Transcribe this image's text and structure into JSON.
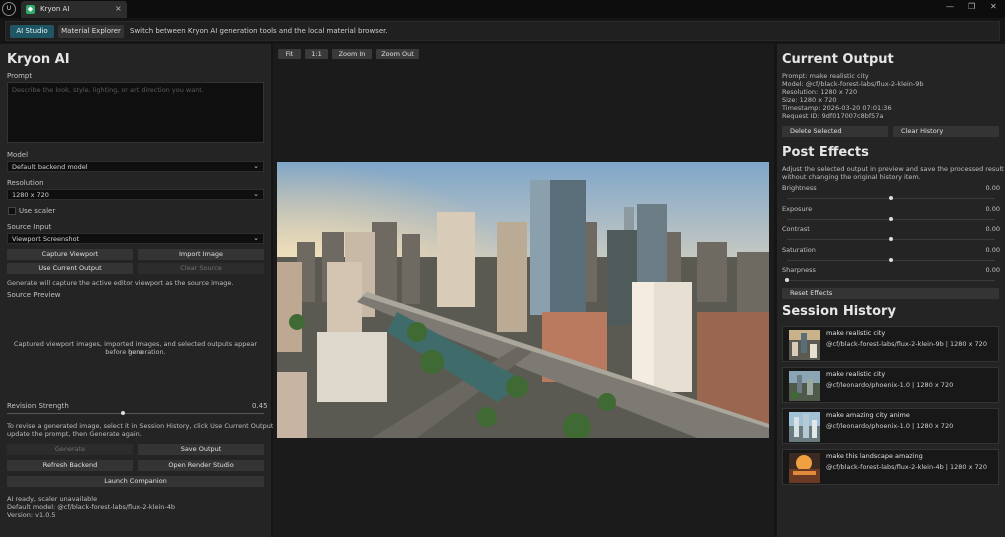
{
  "titlebar": {
    "logo": "U",
    "tab_label": "Kryon AI",
    "tab_close": "×",
    "win_min": "—",
    "win_max": "❐",
    "win_close": "✕"
  },
  "toolbar": {
    "ai_studio": "AI Studio",
    "material_explorer": "Material Explorer",
    "description": "Switch between Kryon AI generation tools and the local material browser."
  },
  "left": {
    "title": "Kryon AI",
    "prompt_label": "Prompt",
    "prompt_placeholder": "Describe the look, style, lighting, or art direction you want.",
    "model_label": "Model",
    "model_value": "Default backend model",
    "resolution_label": "Resolution",
    "resolution_value": "1280 x 720",
    "use_scaler": "Use scaler",
    "source_input_label": "Source Input",
    "source_input_value": "Viewport Screenshot",
    "capture_viewport": "Capture Viewport",
    "import_image": "Import Image",
    "use_current_output": "Use Current Output",
    "clear_source": "Clear Source",
    "source_note": "Generate will capture the active editor viewport as the source image.",
    "source_preview_label": "Source Preview",
    "source_preview_text_1": "Captured viewport images, imported images, and selected outputs appear here",
    "source_preview_text_2": "before generation.",
    "revision_strength_label": "Revision Strength",
    "revision_strength_value": "0.45",
    "revision_strength": 0.45,
    "revise_note_1": "To revise a generated image, select it in Session History, click Use Current Output,",
    "revise_note_2": "update the prompt, then Generate again.",
    "generate": "Generate",
    "save_output": "Save Output",
    "refresh_backend": "Refresh Backend",
    "open_render_studio": "Open Render Studio",
    "launch_companion": "Launch Companion",
    "status_1": "AI ready, scaler unavailable",
    "status_2": "Default model: @cf/black-forest-labs/flux-2-klein-4b",
    "status_3": "Version: v1.0.5"
  },
  "center": {
    "fit": "Fit",
    "one_to_one": "1:1",
    "zoom_in": "Zoom In",
    "zoom_out": "Zoom Out"
  },
  "right": {
    "current_output_title": "Current Output",
    "prompt": "Prompt: make realistic  city",
    "model": "Model: @cf/black-forest-labs/flux-2-klein-9b",
    "resolution": "Resolution: 1280 x 720",
    "size": "Size: 1280 x 720",
    "timestamp": "Timestamp: 2026-03-20 07:01:36",
    "request_id": "Request ID: 9df017007c8bf57a",
    "delete_selected": "Delete Selected",
    "clear_history": "Clear History",
    "post_effects_title": "Post Effects",
    "post_effects_desc_1": "Adjust the selected output in preview and save the processed result",
    "post_effects_desc_2": "without changing the original history item.",
    "effects": [
      {
        "name": "Brightness",
        "value": "0.00",
        "level": 0.5
      },
      {
        "name": "Exposure",
        "value": "0.00",
        "level": 0.5
      },
      {
        "name": "Contrast",
        "value": "0.00",
        "level": 0.5
      },
      {
        "name": "Saturation",
        "value": "0.00",
        "level": 0.5
      },
      {
        "name": "Sharpness",
        "value": "0.00",
        "level": 0.0
      }
    ],
    "reset_effects": "Reset Effects",
    "session_history_title": "Session History",
    "history": [
      {
        "title": "make realistic  city",
        "sub": "@cf/black-forest-labs/flux-2-klein-9b | 1280 x 720"
      },
      {
        "title": "make realistic  city",
        "sub": "@cf/leonardo/phoenix-1.0 | 1280 x 720"
      },
      {
        "title": "make amazing city anime",
        "sub": "@cf/leonardo/phoenix-1.0 | 1280 x 720"
      },
      {
        "title": "make this landscape amazing",
        "sub": "@cf/black-forest-labs/flux-2-klein-4b | 1280 x 720"
      }
    ]
  }
}
